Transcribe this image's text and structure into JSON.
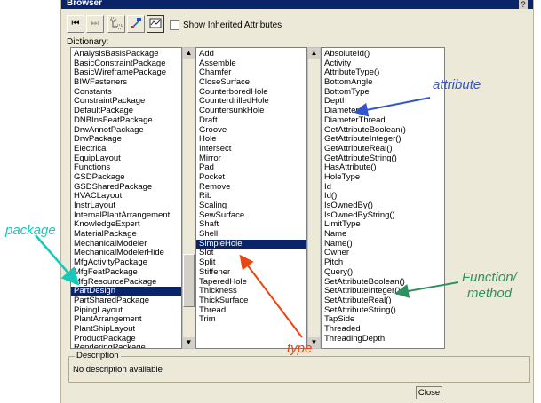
{
  "window": {
    "title": "Browser",
    "help_glyph": "?"
  },
  "toolbar": {
    "buttons": [
      "first-icon",
      "next-icon",
      "hierarchy-icon",
      "inherit-icon",
      "graph-icon"
    ],
    "show_inherited_label": "Show Inherited Attributes"
  },
  "dictionary": {
    "label": "Dictionary:",
    "packages": [
      "AnalysisBasisPackage",
      "BasicConstraintPackage",
      "BasicWireframePackage",
      "BIWFasteners",
      "Constants",
      "ConstraintPackage",
      "DefaultPackage",
      "DNBInsFeatPackage",
      "DrwAnnotPackage",
      "DrwPackage",
      "Electrical",
      "EquipLayout",
      "Functions",
      "GSDPackage",
      "GSDSharedPackage",
      "HVACLayout",
      "InstrLayout",
      "InternalPlantArrangement",
      "KnowledgeExpert",
      "MaterialPackage",
      "MechanicalModeler",
      "MechanicalModelerHide",
      "MfgActivityPackage",
      "MfgFeatPackage",
      "MfgResourcePackage",
      "PartDesign",
      "PartSharedPackage",
      "PipingLayout",
      "PlantArrangement",
      "PlantShipLayout",
      "ProductPackage",
      "RenderingPackage"
    ],
    "selected_package": "PartDesign",
    "types": [
      "Add",
      "Assemble",
      "Chamfer",
      "CloseSurface",
      "CounterboredHole",
      "CounterdrilledHole",
      "CountersunkHole",
      "Draft",
      "Groove",
      "Hole",
      "Intersect",
      "Mirror",
      "Pad",
      "Pocket",
      "Remove",
      "Rib",
      "Scaling",
      "SewSurface",
      "Shaft",
      "Shell",
      "SimpleHole",
      "Slot",
      "Split",
      "Stiffener",
      "TaperedHole",
      "Thickness",
      "ThickSurface",
      "Thread",
      "Trim"
    ],
    "selected_type": "SimpleHole",
    "members": [
      "AbsoluteId()",
      "Activity",
      "AttributeType()",
      "BottomAngle",
      "BottomType",
      "Depth",
      "Diameter",
      "DiameterThread",
      "GetAttributeBoolean()",
      "GetAttributeInteger()",
      "GetAttributeReal()",
      "GetAttributeString()",
      "HasAttribute()",
      "HoleType",
      "Id",
      "Id()",
      "IsOwnedBy()",
      "IsOwnedByString()",
      "LimitType",
      "Name",
      "Name()",
      "Owner",
      "Pitch",
      "Query()",
      "SetAttributeBoolean()",
      "SetAttributeInteger()",
      "SetAttributeReal()",
      "SetAttributeString()",
      "TapSide",
      "Threaded",
      "ThreadingDepth"
    ]
  },
  "description": {
    "legend": "Description",
    "text": "No description available"
  },
  "buttons": {
    "close": "Close"
  },
  "annotations": {
    "attribute": "attribute",
    "package": "package",
    "function": "Function/",
    "method": "method",
    "type": "type"
  },
  "colors": {
    "selection": "#0a246a",
    "attribute_anno": "#3355cc",
    "package_anno": "#16c9b8",
    "function_anno": "#2f9060",
    "type_anno": "#ee4411"
  }
}
